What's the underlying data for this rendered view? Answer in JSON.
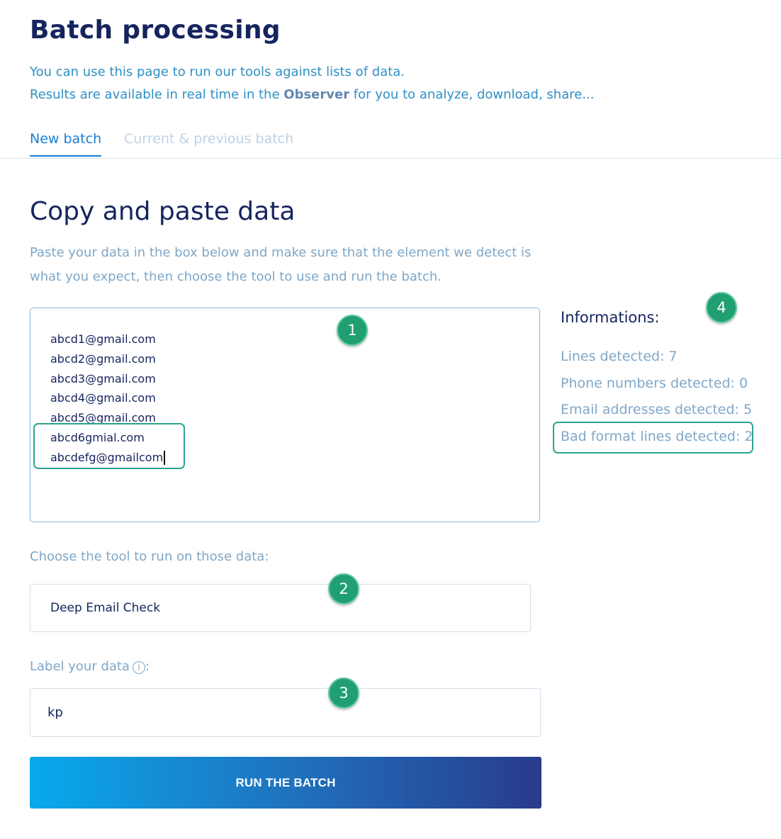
{
  "header": {
    "title": "Batch processing",
    "intro_line1": "You can use this page to run our tools against lists of data.",
    "intro_line2_prefix": "Results are available in real time in the ",
    "intro_line2_bold": "Observer",
    "intro_line2_suffix": " for you to analyze, download, share..."
  },
  "tabs": [
    {
      "label": "New batch",
      "active": true
    },
    {
      "label": "Current & previous batch",
      "active": false
    }
  ],
  "section": {
    "title": "Copy and paste data",
    "description": "Paste your data in the box below and make sure that the element we detect is what you expect, then choose the tool to use and run the batch."
  },
  "data_box": {
    "lines": [
      "abcd1@gmail.com",
      "abcd2@gmail.com",
      "abcd3@gmail.com",
      "abcd4@gmail.com",
      "abcd5@gmail.com",
      "abcd6gmial.com",
      "abcdefg@gmailcom"
    ]
  },
  "informations": {
    "title": "Informations:",
    "lines_detected": "Lines detected: 7",
    "phone_numbers": "Phone numbers detected: 0",
    "email_addresses": "Email addresses detected: 5",
    "bad_format": "Bad format lines detected: 2"
  },
  "tool": {
    "label": "Choose the tool to run on those data:",
    "selected": "Deep Email Check"
  },
  "data_label": {
    "label": "Label your data",
    "info_glyph": "i",
    "value": "kp"
  },
  "run_button": "RUN THE BATCH",
  "badges": [
    "1",
    "2",
    "3",
    "4"
  ],
  "colors": {
    "navy": "#16245e",
    "accent_blue": "#1a7fd4",
    "muted_blue": "#7fa7c8",
    "annotation_green": "#1f9f72",
    "highlight_border": "#2aa58e"
  }
}
